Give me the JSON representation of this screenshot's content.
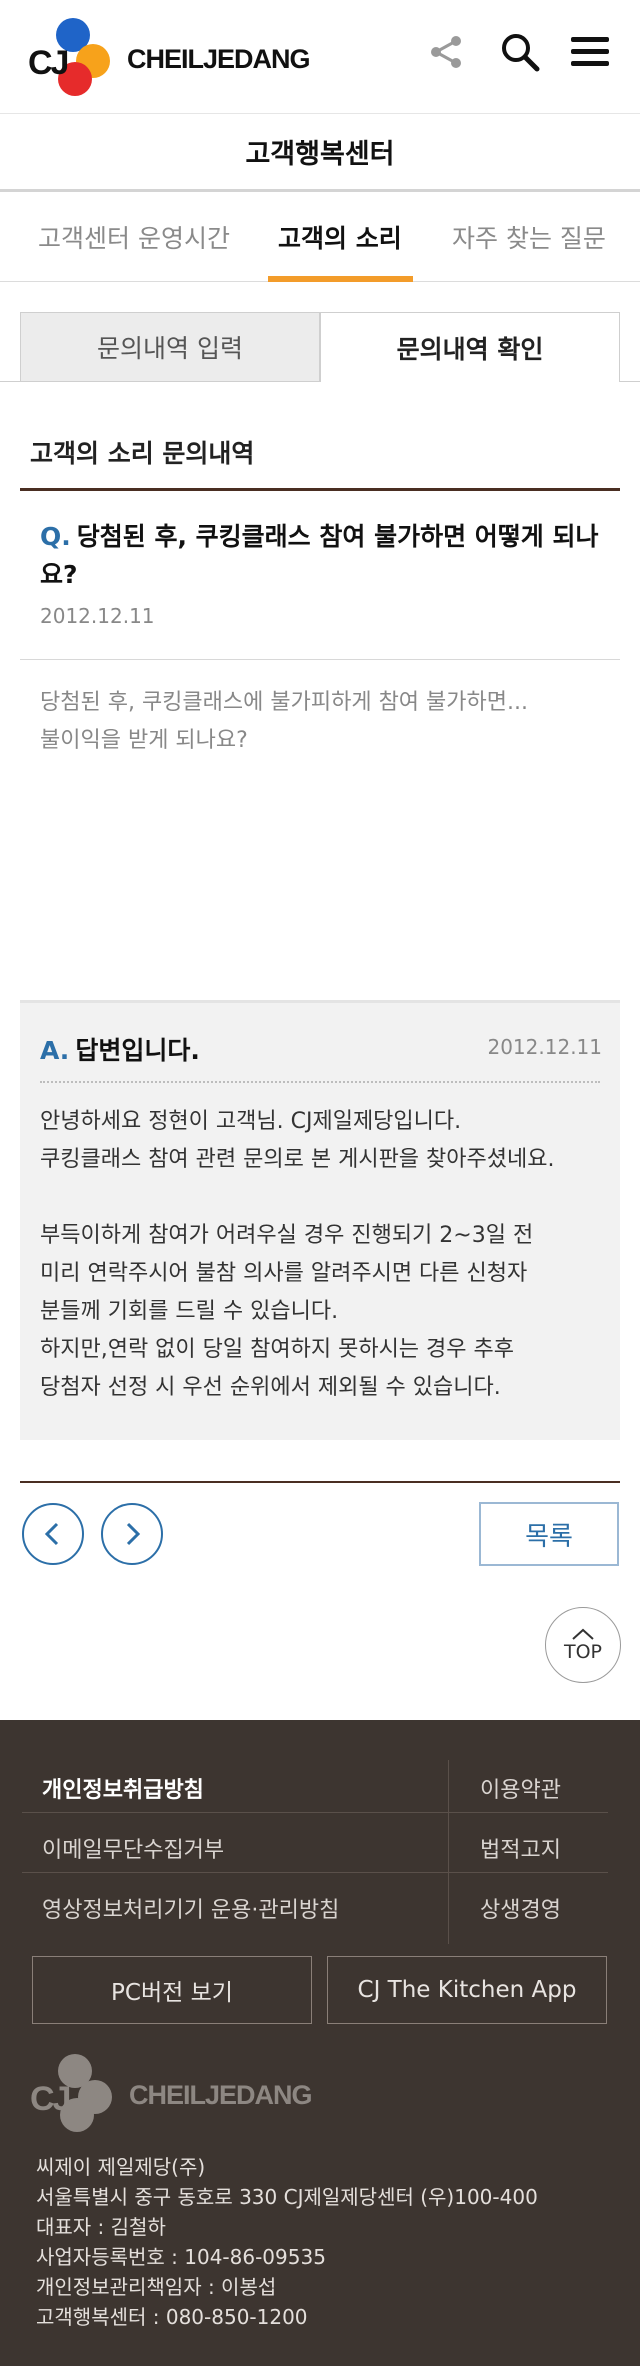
{
  "brand": {
    "logo_mark": "CJ",
    "logo_text": "CHEILJEDANG"
  },
  "header": {
    "icons": [
      "share-icon",
      "search-icon",
      "menu-icon"
    ]
  },
  "page_title": "고객행복센터",
  "subnav": {
    "tabs": [
      {
        "label": "고객센터 운영시간",
        "active": false
      },
      {
        "label": "고객의 소리",
        "active": true
      },
      {
        "label": "자주 찾는 질문",
        "active": false
      }
    ],
    "accent_color": "#f39c2a"
  },
  "toggle": {
    "input_label": "문의내역 입력",
    "check_label": "문의내역 확인",
    "selected": "문의내역 확인"
  },
  "section": {
    "title": "고객의 소리 문의내역"
  },
  "question": {
    "prefix": "Q.",
    "title": "당첨된 후, 쿠킹클래스 참여 불가하면 어떻게 되나요?",
    "date": "2012.12.11",
    "body_lines": [
      "당첨된 후, 쿠킹클래스에 불가피하게 참여 불가하면...",
      "불이익을 받게 되나요?"
    ]
  },
  "answer": {
    "prefix": "A.",
    "title": "답변입니다.",
    "date": "2012.12.11",
    "body_lines": [
      "안녕하세요 정현이 고객님. CJ제일제당입니다.",
      "쿠킹클래스 참여 관련 문의로 본 게시판을 찾아주셨네요.",
      "",
      "부득이하게 참여가 어려우실 경우 진행되기 2~3일 전",
      "미리 연락주시어 불참 의사를 알려주시면 다른 신청자",
      "분들께 기회를 드릴 수 있습니다.",
      "하지만,연락 없이 당일 참여하지 못하시는 경우 추후",
      "당첨자 선정 시 우선 순위에서 제외될 수 있습니다."
    ]
  },
  "pager": {
    "list_label": "목록",
    "top_label": "TOP"
  },
  "footer": {
    "links_left": [
      "개인정보취급방침",
      "이메일무단수집거부",
      "영상정보처리기기 운용·관리방침"
    ],
    "links_right": [
      "이용약관",
      "법적고지",
      "상생경영"
    ],
    "buttons": [
      "PC버전 보기",
      "CJ The Kitchen App"
    ],
    "company_info": [
      "씨제이 제일제당(주)",
      "서울특별시 중구 동호로 330 CJ제일제당센터 (우)100-400",
      "대표자 : 김철하",
      "사업자등록번호 : 104-86-09535",
      "개인정보관리책임자 : 이봉섭",
      "고객행복센터 : 080-850-1200"
    ]
  },
  "colors": {
    "brand_brown": "#4a2e22",
    "link_blue": "#2c6fa8",
    "footer_bg": "#3d3530"
  }
}
